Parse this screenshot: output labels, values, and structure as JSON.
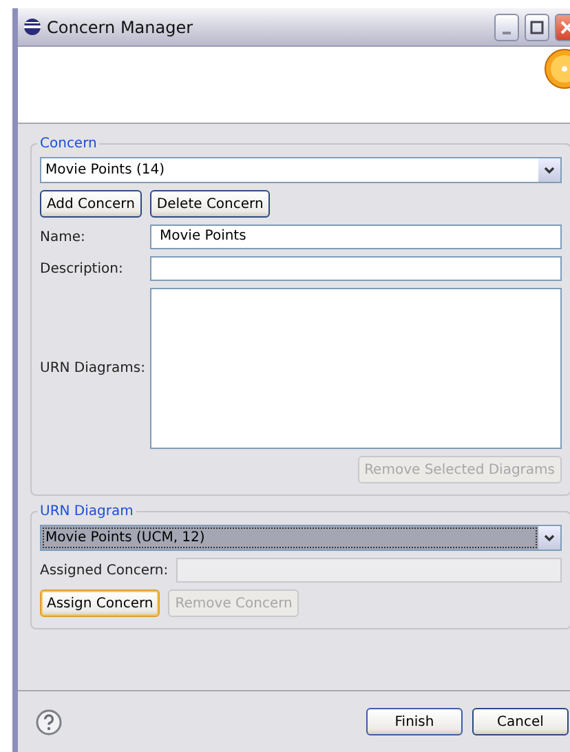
{
  "window": {
    "title": "Concern Manager"
  },
  "concern_group": {
    "title": "Concern",
    "combo": {
      "value": "Movie Points (14)",
      "highlighted": false
    },
    "buttons": [
      {
        "label": "Add Concern",
        "disabled": false,
        "focused": false
      },
      {
        "label": "Delete Concern",
        "disabled": false,
        "focused": false
      }
    ],
    "name": {
      "label": "Name:",
      "value": "Movie Points"
    },
    "description": {
      "label": "Description:"
    },
    "urn_diagrams": {
      "label": "URN Diagrams:"
    },
    "remove_button": {
      "label": "Remove Selected Diagrams",
      "disabled": true,
      "focused": false
    }
  },
  "urn_group": {
    "title": "URN Diagram",
    "combo": {
      "value": "Movie Points (UCM, 12)",
      "highlighted": true
    },
    "assigned": {
      "label": "Assigned Concern:",
      "disabled": true
    },
    "buttons": [
      {
        "label": "Assign Concern",
        "disabled": false,
        "focused": true
      },
      {
        "label": "Remove Concern",
        "disabled": true,
        "focused": false
      }
    ]
  },
  "footer": {
    "buttons": [
      {
        "label": "Finish",
        "disabled": false,
        "focused": false,
        "default": true
      },
      {
        "label": "Cancel",
        "disabled": false,
        "focused": false,
        "default": false
      }
    ]
  }
}
